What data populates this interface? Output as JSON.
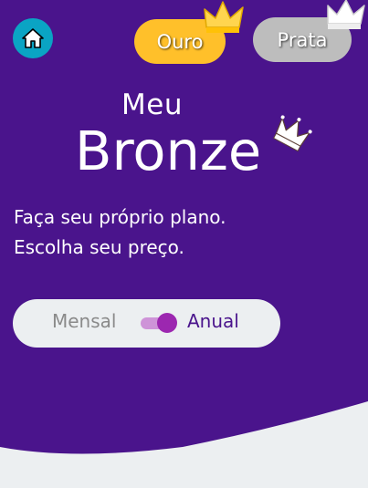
{
  "colors": {
    "background_purple": "#4A148C",
    "bottom_grey": "#ECEFF1",
    "home_button": "#0AA4C4",
    "ouro": "#FFC02A",
    "prata": "#BDBDBD",
    "toggle_on": "#9C27B0",
    "toggle_track": "#CE93D8"
  },
  "header": {
    "home_icon": "home-icon",
    "tiers": [
      {
        "label": "Ouro",
        "icon": "crown-icon"
      },
      {
        "label": "Prata",
        "icon": "crown-icon"
      }
    ]
  },
  "plan": {
    "title_small": "Meu",
    "title_large": "Bronze",
    "icon": "crown-icon",
    "tagline_line1": "Faça seu próprio plano.",
    "tagline_line2": "Escolha seu preço."
  },
  "billing": {
    "option_left": "Mensal",
    "option_right": "Anual",
    "selected": "Anual"
  }
}
